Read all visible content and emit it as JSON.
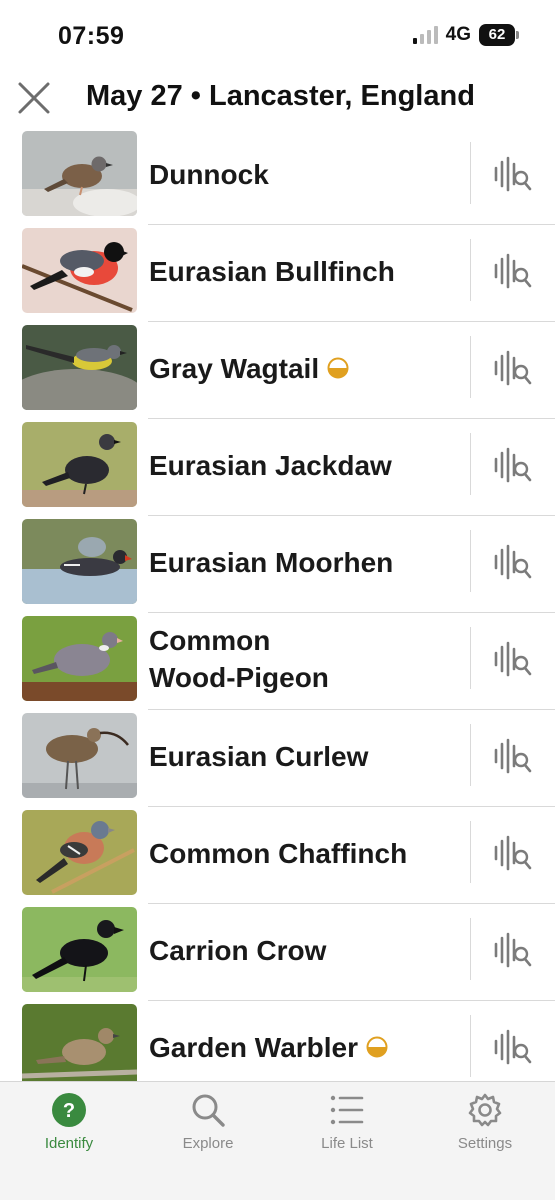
{
  "status_bar": {
    "time": "07:59",
    "network": "4G",
    "battery": "62"
  },
  "header": {
    "title": "May 27 • Lancaster, England",
    "close_icon": "close-icon"
  },
  "species": [
    {
      "name": "Dunnock",
      "seasonal": false
    },
    {
      "name": "Eurasian Bullfinch",
      "seasonal": false
    },
    {
      "name": "Gray Wagtail",
      "seasonal": true
    },
    {
      "name": "Eurasian Jackdaw",
      "seasonal": false
    },
    {
      "name": "Eurasian Moorhen",
      "seasonal": false
    },
    {
      "name": "Common Wood-Pigeon",
      "seasonal": false
    },
    {
      "name": "Eurasian Curlew",
      "seasonal": false
    },
    {
      "name": "Common Chaffinch",
      "seasonal": false
    },
    {
      "name": "Carrion Crow",
      "seasonal": false
    },
    {
      "name": "Garden Warbler",
      "seasonal": true
    }
  ],
  "tabs": [
    {
      "label": "Identify",
      "icon": "question-circle-icon",
      "active": true
    },
    {
      "label": "Explore",
      "icon": "search-icon",
      "active": false
    },
    {
      "label": "Life List",
      "icon": "list-icon",
      "active": false
    },
    {
      "label": "Settings",
      "icon": "gear-icon",
      "active": false
    }
  ],
  "colors": {
    "accent": "#3a8a3f",
    "badge": "#e0a020",
    "text": "#1a1a1a",
    "muted": "#8a8a8a"
  }
}
